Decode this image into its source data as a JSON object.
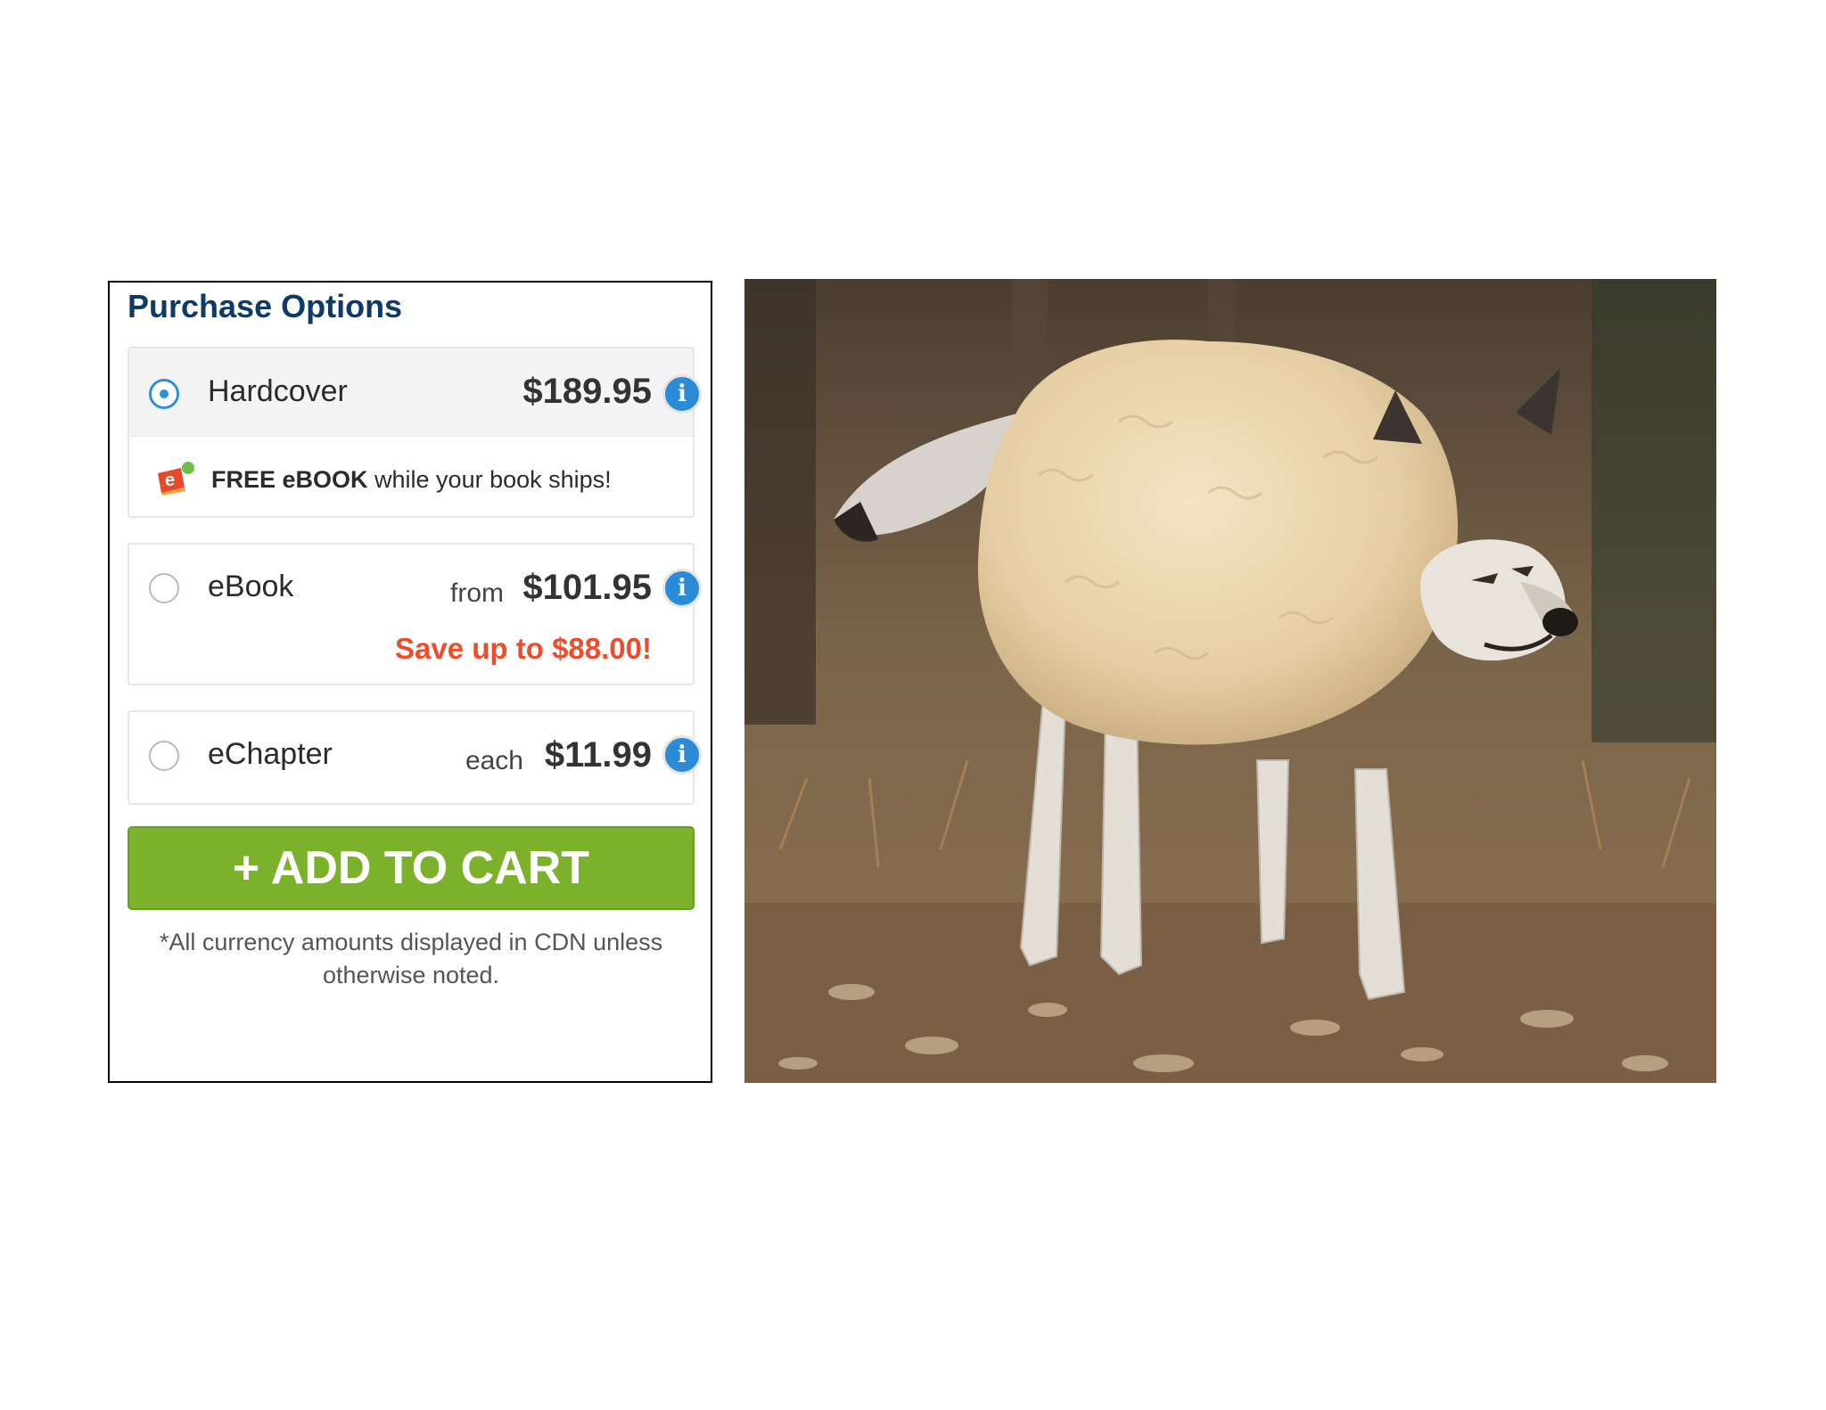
{
  "panel": {
    "title": "Purchase Options",
    "options": [
      {
        "label": "Hardcover",
        "price": "$189.95",
        "selected": true,
        "promo_bold": "FREE eBOOK",
        "promo_rest": " while your book ships!"
      },
      {
        "label": "eBook",
        "prefix": "from",
        "price": "$101.95",
        "selected": false,
        "save": "Save up to $88.00!"
      },
      {
        "label": "eChapter",
        "prefix": "each",
        "price": "$11.99",
        "selected": false
      }
    ],
    "info_glyph": "i",
    "cart": "+ ADD TO CART",
    "currency_note": "*All currency amounts displayed in CDN unless otherwise noted."
  },
  "colors": {
    "accent": "#2d8fe0",
    "cart": "#7bb12b",
    "save": "#ef4d2a",
    "title": "#0f3a68"
  },
  "icons": [
    "info-icon",
    "ebook-icon",
    "radio-selected",
    "radio-empty"
  ]
}
